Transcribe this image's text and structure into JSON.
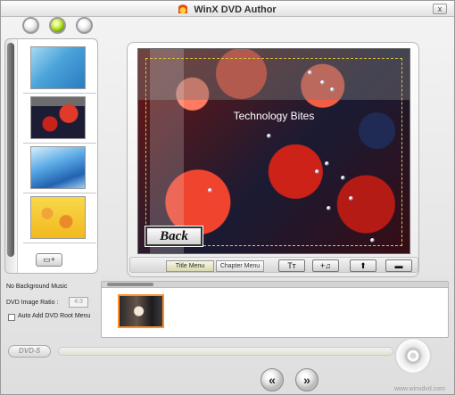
{
  "window": {
    "title": "WinX DVD Author",
    "close_label": "x"
  },
  "preview": {
    "menu_title": "Technology Bites",
    "back_button": "Back"
  },
  "tabs": [
    {
      "label": "Title Menu"
    },
    {
      "label": "Chapter Menu"
    }
  ],
  "toolbar": {
    "add_background": "▭+",
    "text_tool": "Tт",
    "music_tool": "+♫",
    "up_tool": "⬆",
    "down_tool": "▬"
  },
  "settings": {
    "background_music": "No Background Music",
    "image_ratio_label": "DVD Image Ratio :",
    "image_ratio_value": "4:3",
    "root_menu_label": "Auto Add DVD Root Menu"
  },
  "bottom": {
    "dvd_type": "DVD-5"
  },
  "navigation": {
    "prev": "«",
    "next": "»"
  },
  "footer": {
    "url": "www.winxdvd.com"
  },
  "colors": {
    "accent_green": "#b8e42a",
    "chapter_border": "#ff8f2c"
  }
}
